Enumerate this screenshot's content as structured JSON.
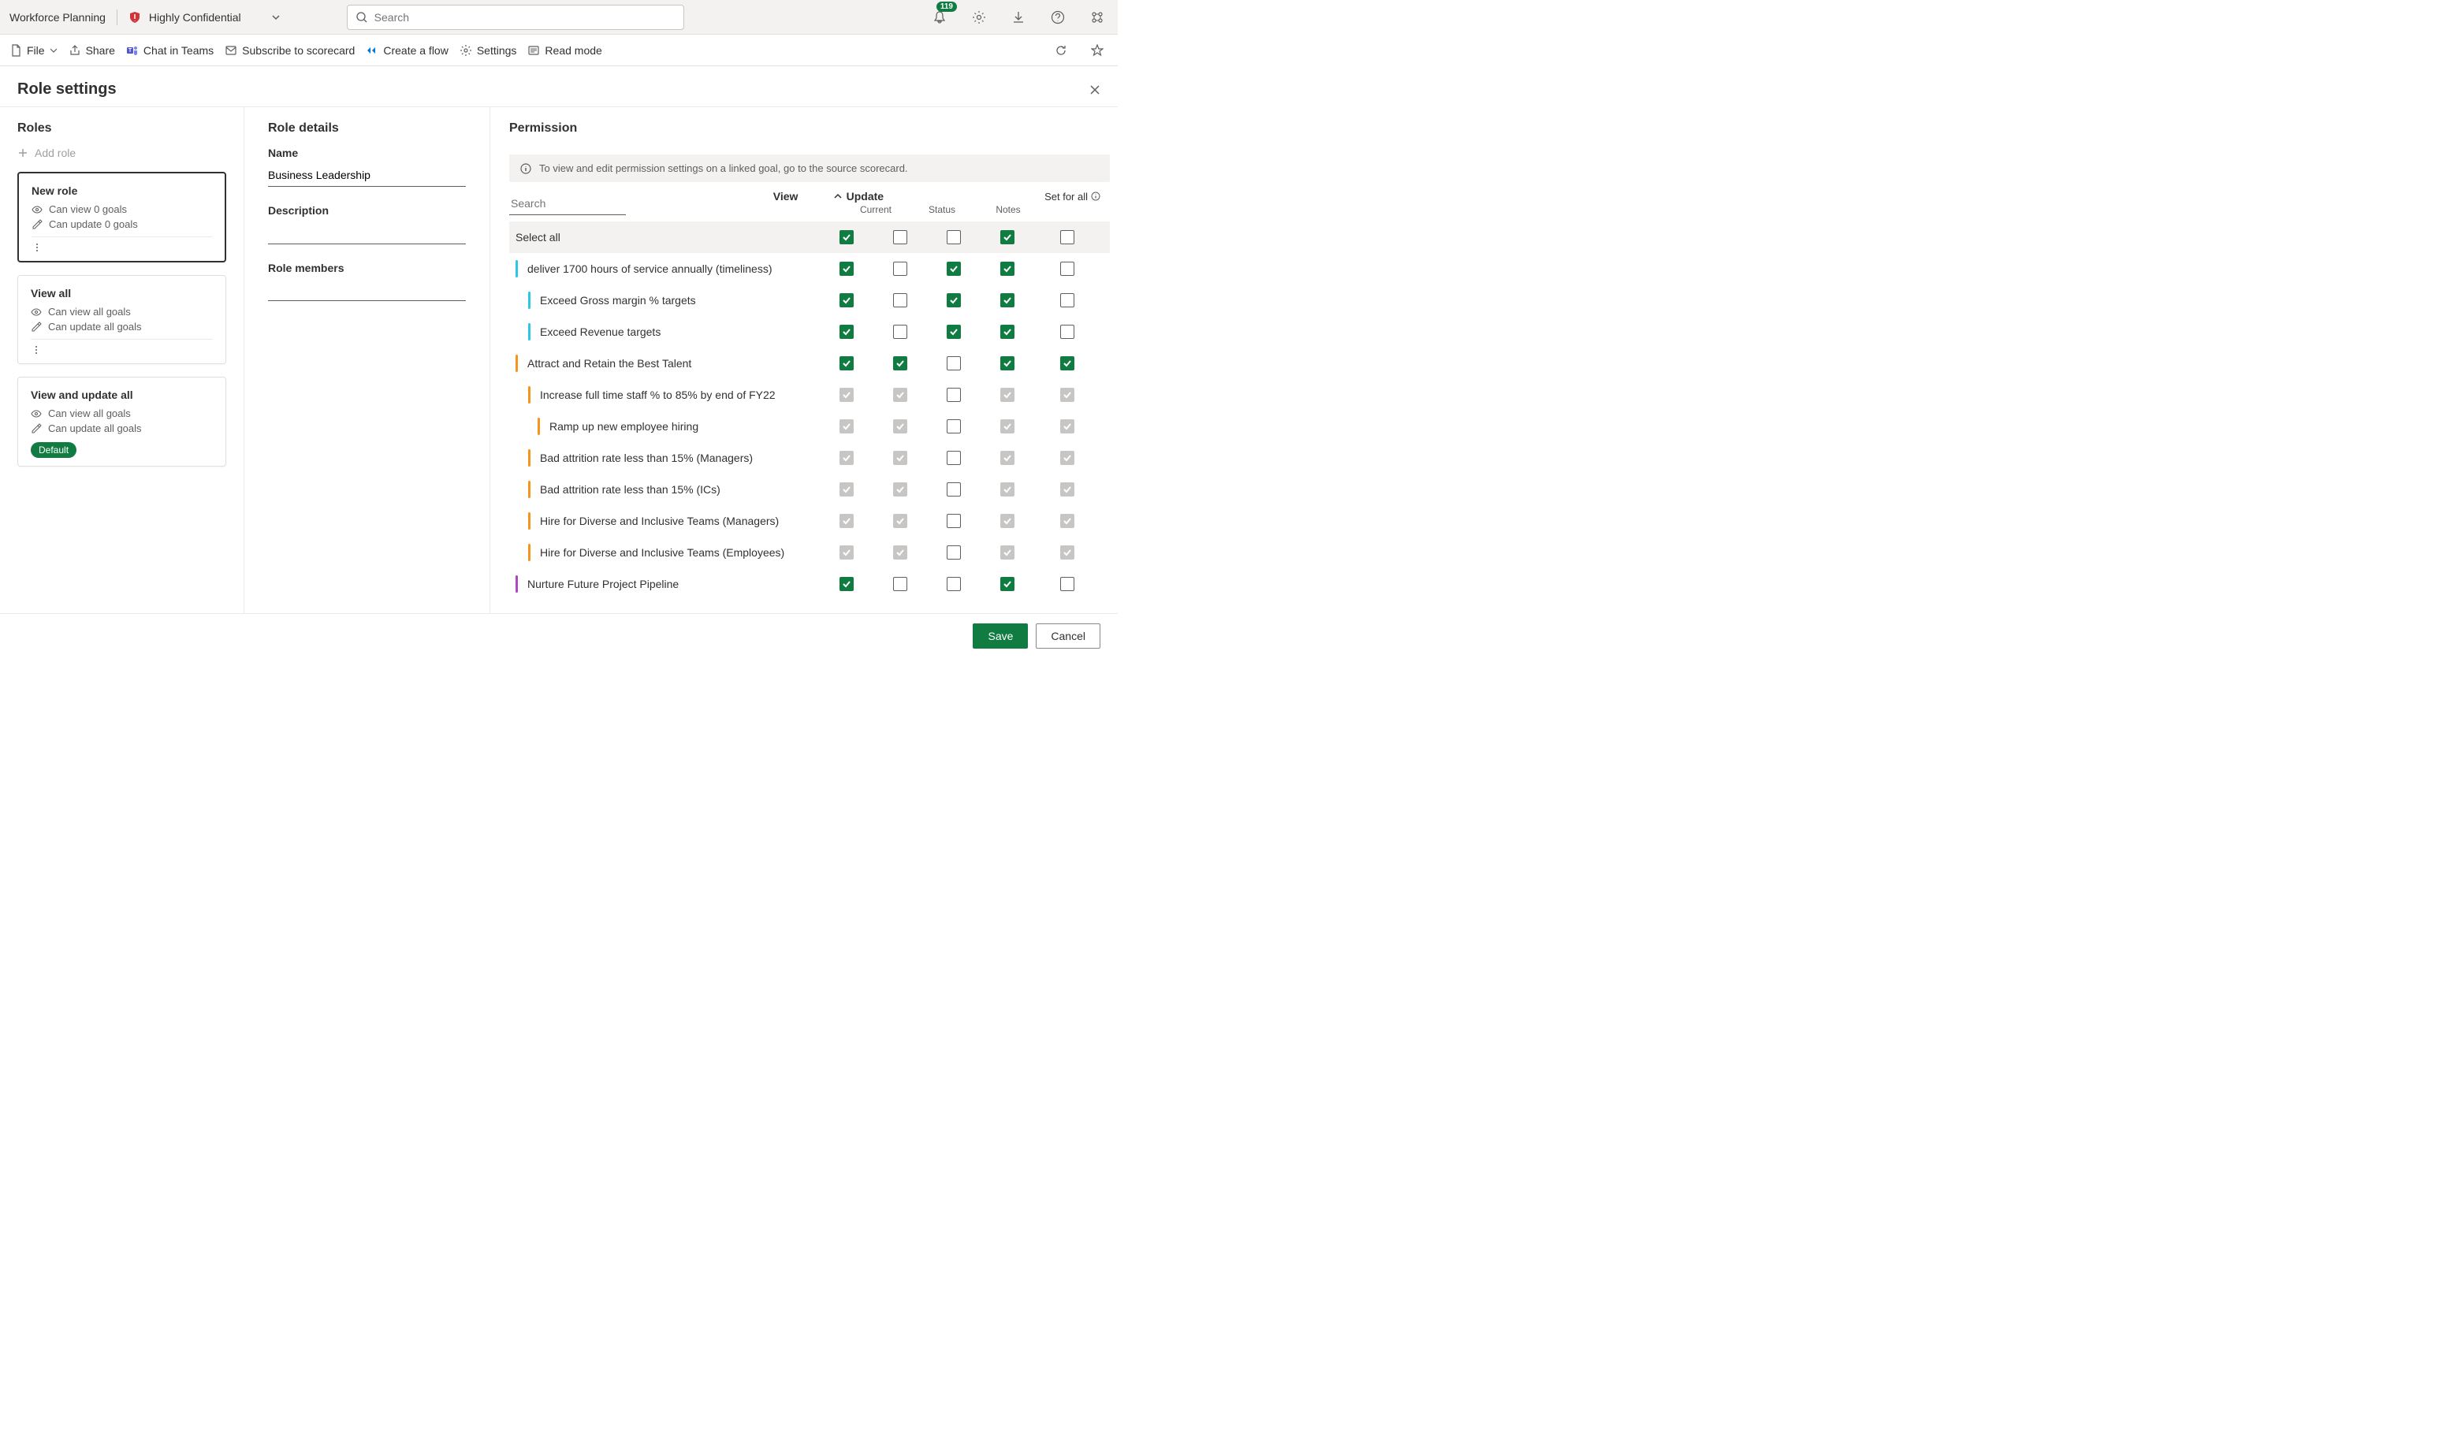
{
  "header": {
    "app_name": "Workforce Planning",
    "classification": "Highly Confidential",
    "search_placeholder": "Search",
    "notification_count": "119"
  },
  "toolbar": {
    "file": "File",
    "share": "Share",
    "chat_in_teams": "Chat in Teams",
    "subscribe": "Subscribe to scorecard",
    "create_flow": "Create a flow",
    "settings": "Settings",
    "read_mode": "Read mode"
  },
  "page": {
    "title": "Role settings"
  },
  "roles_panel": {
    "title": "Roles",
    "add_role": "Add role",
    "cards": [
      {
        "title": "New role",
        "view_line": "Can view 0 goals",
        "update_line": "Can update 0 goals",
        "selected": true,
        "more": true,
        "default": false
      },
      {
        "title": "View all",
        "view_line": "Can view all goals",
        "update_line": "Can update all goals",
        "selected": false,
        "more": true,
        "default": false
      },
      {
        "title": "View and update all",
        "view_line": "Can view all goals",
        "update_line": "Can update all goals",
        "selected": false,
        "more": false,
        "default": true
      }
    ],
    "default_label": "Default"
  },
  "details": {
    "title": "Role details",
    "name_label": "Name",
    "name_value": "Business Leadership",
    "description_label": "Description",
    "members_label": "Role members"
  },
  "permission": {
    "title": "Permission",
    "banner": "To view and edit permission settings on a linked goal, go to the source scorecard.",
    "search_placeholder": "Search",
    "view_col": "View",
    "update_col": "Update",
    "sub_current": "Current",
    "sub_status": "Status",
    "sub_notes": "Notes",
    "set_for_all": "Set for all",
    "select_all_label": "Select all",
    "select_all_checks": {
      "view": "checked",
      "current": "unchecked",
      "status": "unchecked",
      "notes": "checked",
      "set": "unchecked"
    },
    "rows": [
      {
        "label": "deliver 1700 hours of service annually (timeliness)",
        "color": "#2cc6e8",
        "indent": 0,
        "view": "checked",
        "current": "unchecked",
        "status": "checked",
        "notes": "checked",
        "set": "unchecked"
      },
      {
        "label": "Exceed Gross margin % targets",
        "color": "#2cc6e8",
        "indent": 1,
        "view": "checked",
        "current": "unchecked",
        "status": "checked",
        "notes": "checked",
        "set": "unchecked"
      },
      {
        "label": "Exceed Revenue targets",
        "color": "#2cc6e8",
        "indent": 1,
        "view": "checked",
        "current": "unchecked",
        "status": "checked",
        "notes": "checked",
        "set": "unchecked"
      },
      {
        "label": "Attract and Retain the Best Talent",
        "color": "#f7941e",
        "indent": 0,
        "view": "checked",
        "current": "checked",
        "status": "unchecked",
        "notes": "checked",
        "set": "checked"
      },
      {
        "label": "Increase full time staff % to 85% by end of FY22",
        "color": "#f7941e",
        "indent": 1,
        "view": "disabled",
        "current": "disabled",
        "status": "unchecked",
        "notes": "disabled",
        "set": "disabled"
      },
      {
        "label": "Ramp up new employee hiring",
        "color": "#f7941e",
        "indent": 2,
        "view": "disabled",
        "current": "disabled",
        "status": "unchecked",
        "notes": "disabled",
        "set": "disabled"
      },
      {
        "label": "Bad attrition rate less than 15% (Managers)",
        "color": "#f7941e",
        "indent": 1,
        "view": "disabled",
        "current": "disabled",
        "status": "unchecked",
        "notes": "disabled",
        "set": "disabled"
      },
      {
        "label": "Bad attrition rate less than 15% (ICs)",
        "color": "#f7941e",
        "indent": 1,
        "view": "disabled",
        "current": "disabled",
        "status": "unchecked",
        "notes": "disabled",
        "set": "disabled"
      },
      {
        "label": "Hire for Diverse and Inclusive Teams (Managers)",
        "color": "#f7941e",
        "indent": 1,
        "view": "disabled",
        "current": "disabled",
        "status": "unchecked",
        "notes": "disabled",
        "set": "disabled"
      },
      {
        "label": "Hire for Diverse and Inclusive Teams (Employees)",
        "color": "#f7941e",
        "indent": 1,
        "view": "disabled",
        "current": "disabled",
        "status": "unchecked",
        "notes": "disabled",
        "set": "disabled"
      },
      {
        "label": "Nurture Future Project Pipeline",
        "color": "#b146c2",
        "indent": 0,
        "view": "checked",
        "current": "unchecked",
        "status": "unchecked",
        "notes": "checked",
        "set": "unchecked"
      }
    ]
  },
  "footer": {
    "save": "Save",
    "cancel": "Cancel"
  }
}
